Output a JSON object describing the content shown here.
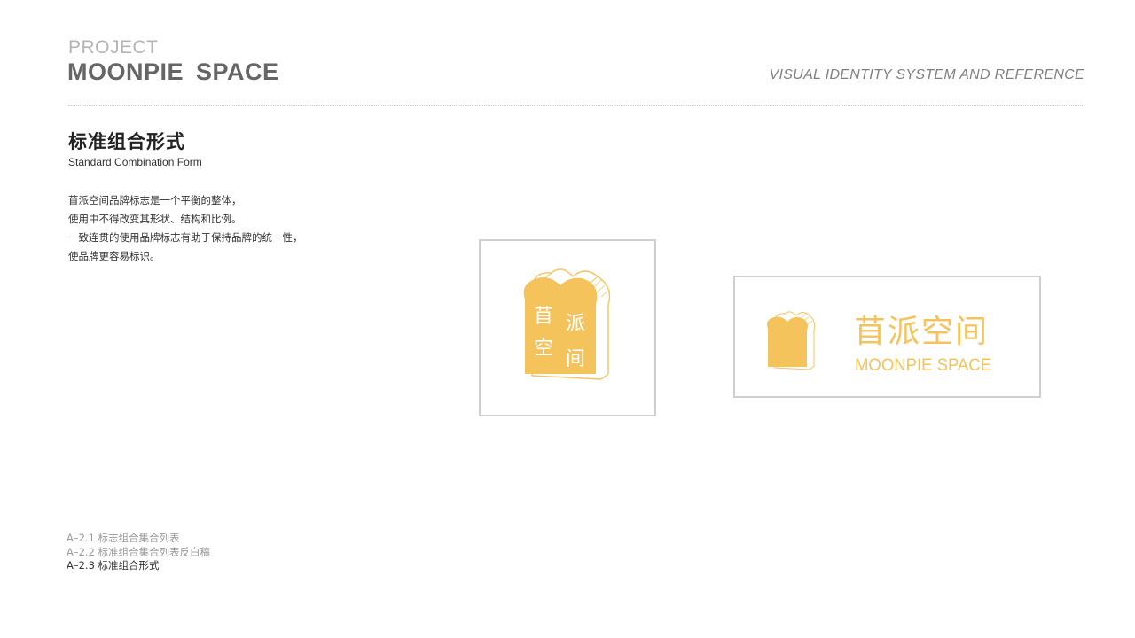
{
  "header": {
    "project_label": "PROJECT",
    "project_name": "MOONPIE  SPACE",
    "right_title": "VISUAL  IDENTITY  SYSTEM  AND  REFERENCE"
  },
  "section": {
    "title": "标准组合形式",
    "subtitle": "Standard Combination Form",
    "description": [
      "苜派空间品牌标志是一个平衡的整体，",
      "使用中不得改变其形状、结构和比例。",
      "一致连贯的使用品牌标志有助于保持品牌的统一性，",
      "使品牌更容易标识。"
    ]
  },
  "logo": {
    "chinese_name": "苜派空间",
    "chars": [
      "苜",
      "派",
      "空",
      "间"
    ],
    "english_name": "MOONPIE SPACE",
    "brand_color": "#F5C35C",
    "icon": "toast-bread-icon"
  },
  "nav": {
    "items": [
      "A–2.1  标志组合集合列表",
      "A–2.2  标准组合集合列表反白稿",
      "A–2.3  标准组合形式"
    ],
    "active_index": 2
  },
  "colors": {
    "heading_gray": "#666666",
    "light_gray": "#b4b4b4",
    "border_gray": "#cfcfcf",
    "accent_yellow": "#F5C35C"
  }
}
